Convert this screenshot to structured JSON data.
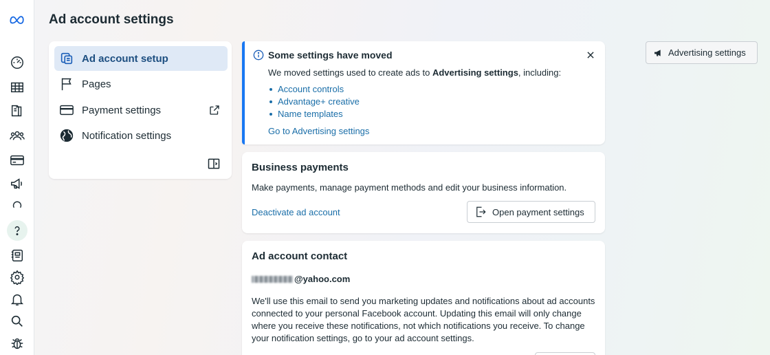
{
  "page": {
    "title": "Ad account settings"
  },
  "rail": {
    "icons": [
      "meta-logo",
      "dashboard-icon",
      "table-icon",
      "catalog-icon",
      "audience-icon",
      "billing-icon",
      "megaphone-icon",
      "loading-icon",
      "help-icon",
      "report-icon",
      "settings-gear-icon",
      "bell-icon",
      "search-icon",
      "bug-icon"
    ]
  },
  "sidebar": {
    "items": [
      {
        "label": "Ad account setup",
        "icon": "ad-account-icon",
        "active": true
      },
      {
        "label": "Pages",
        "icon": "flag-icon"
      },
      {
        "label": "Payment settings",
        "icon": "credit-card-icon",
        "external": true
      },
      {
        "label": "Notification settings",
        "icon": "globe-icon"
      }
    ]
  },
  "notice": {
    "title": "Some settings have moved",
    "text_prefix": "We moved settings used to create ads to ",
    "text_bold": "Advertising settings",
    "text_suffix": ", including:",
    "items": [
      "Account controls",
      "Advantage+ creative",
      "Name templates"
    ],
    "link": "Go to Advertising settings"
  },
  "payments": {
    "title": "Business payments",
    "description": "Make payments, manage payment methods and edit your business information.",
    "deactivate_link": "Deactivate ad account",
    "open_button": "Open payment settings"
  },
  "contact": {
    "title": "Ad account contact",
    "email_domain": "@yahoo.com",
    "description": "We'll use this email to send you marketing updates and notifications about ad accounts connected to your personal Facebook account. Updating this email will only change where you receive these notifications, not which notifications you receive. To change your notification settings, go to your ad account settings."
  },
  "advertising_button": {
    "label": "Advertising settings"
  },
  "colors": {
    "accent": "#1877f2",
    "link": "#1a6ea8",
    "active_bg": "#dfe9f6"
  }
}
